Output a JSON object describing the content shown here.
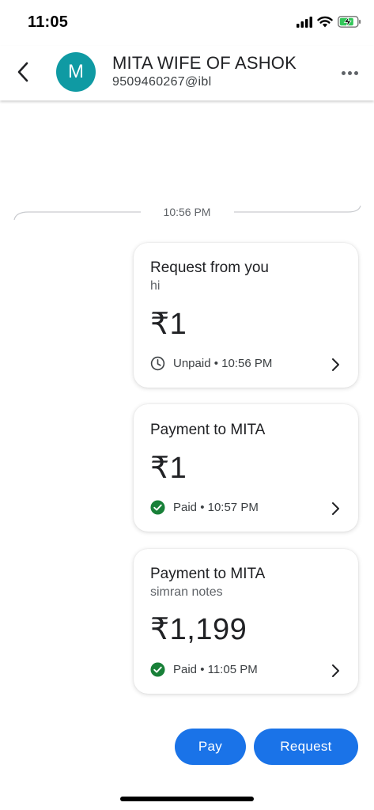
{
  "status_bar": {
    "time": "11:05"
  },
  "header": {
    "avatar_letter": "M",
    "contact_name": "MITA WIFE OF ASHOK",
    "contact_upi": "9509460267@ibl"
  },
  "timeline": {
    "divider_time": "10:56 PM"
  },
  "transactions": [
    {
      "title": "Request from you",
      "note": "hi",
      "amount": "₹1",
      "status": "Unpaid • 10:56 PM",
      "status_icon": "clock-icon"
    },
    {
      "title": "Payment to MITA",
      "note": "",
      "amount": "₹1",
      "status": "Paid • 10:57 PM",
      "status_icon": "check-circle-icon"
    },
    {
      "title": "Payment to MITA",
      "note": "simran notes",
      "amount": "₹1,199",
      "status": "Paid • 11:05 PM",
      "status_icon": "check-circle-icon"
    }
  ],
  "actions": {
    "pay_label": "Pay",
    "request_label": "Request"
  },
  "colors": {
    "accent": "#1a73e8",
    "avatar": "#0f9aa3",
    "paid_green": "#188038"
  }
}
